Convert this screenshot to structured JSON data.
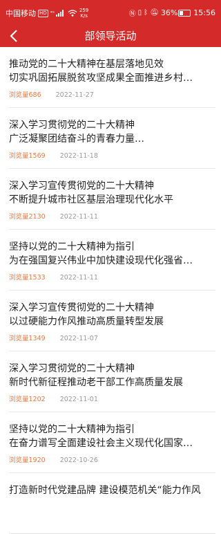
{
  "status_bar": {
    "carrier": "中国移动",
    "hd_badge": "HD",
    "signal": "⁴ᴳ",
    "net_speed_value": "259",
    "net_speed_unit": "K/s",
    "battery_percent": 36,
    "battery_text": "36%",
    "time": "15:56"
  },
  "header": {
    "back_label": "‹",
    "title": "部领导活动"
  },
  "items": [
    {
      "line1": "推动党的二十大精神在基层落地见效",
      "line2": "切实巩固拓展脱贫攻坚成果全面推进乡村…",
      "views": "浏览量686",
      "date": "2022-11-27"
    },
    {
      "line1": "深入学习贯彻党的二十大精神",
      "line2": "广泛凝聚团结奋斗的青春力量…",
      "views": "浏览量1569",
      "date": "2022-11-18"
    },
    {
      "line1": "深入学习宣传贯彻党的二十大精神",
      "line2": "不断提升城市社区基层治理现代化水平",
      "views": "浏览量2130",
      "date": "2022-11-11"
    },
    {
      "line1": "坚持以党的二十大精神为指引",
      "line2": "为在强国复兴伟业中加快建设现代化强省…",
      "views": "浏览量1533",
      "date": "2022-11-11"
    },
    {
      "line1": "深入学习宣传贯彻党的二十大精神",
      "line2": "以过硬能力作风推动高质量转型发展",
      "views": "浏览量1349",
      "date": "2022-11-07"
    },
    {
      "line1": "深入学习贯彻党的二十大精神",
      "line2": "新时代新征程推动老干部工作高质量发展",
      "views": "浏览量1202",
      "date": "2022-11-01"
    },
    {
      "line1": "坚持以党的二十大精神为指引",
      "line2": "在奋力谱写全面建设社会主义现代化国家…",
      "views": "浏览量1920",
      "date": "2022-10-26"
    },
    {
      "line1": "打造新时代党建品牌 建设模范机关“能力作风",
      "line2": "",
      "views": "",
      "date": ""
    }
  ]
}
